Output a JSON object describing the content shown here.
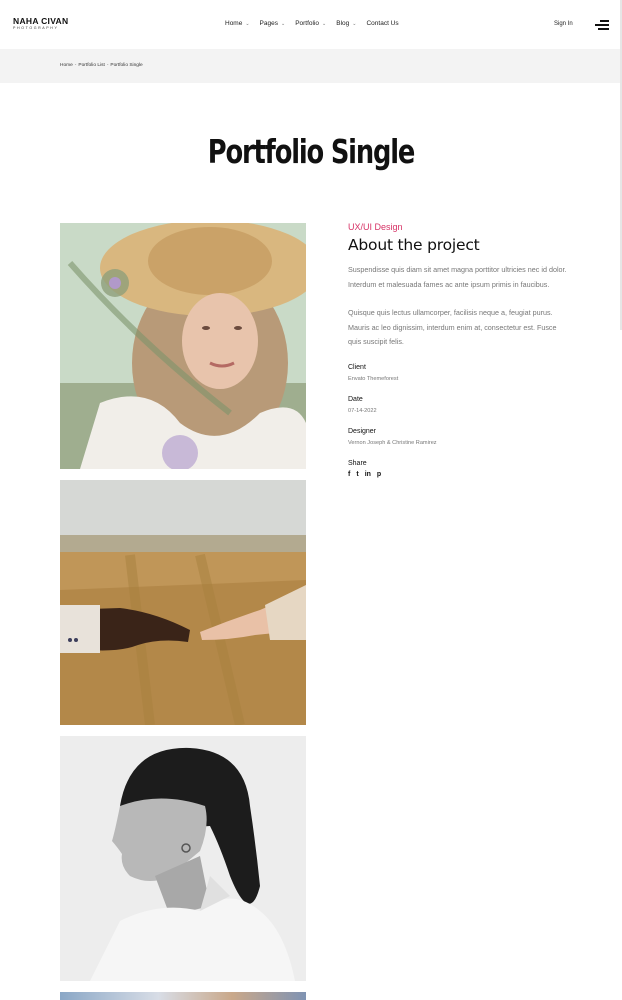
{
  "brand": {
    "name": "NAHA CIVAN",
    "tagline": "PHOTOGRAPHY"
  },
  "nav": {
    "items": [
      {
        "label": "Home",
        "has_dropdown": true
      },
      {
        "label": "Pages",
        "has_dropdown": true
      },
      {
        "label": "Portfolio",
        "has_dropdown": true
      },
      {
        "label": "Blog",
        "has_dropdown": true
      },
      {
        "label": "Contact Us",
        "has_dropdown": false
      }
    ],
    "sign_in": "Sign In",
    "menu_icon": "hamburger-menu-icon"
  },
  "breadcrumb": {
    "items": [
      "Home",
      "Portfolio List",
      "Portfolio Single"
    ],
    "separator": "-"
  },
  "page_title": "Portfolio Single",
  "project": {
    "category": "UX/UI Design",
    "title": "About the project",
    "paragraph_1": "Suspendisse quis diam sit amet magna porttitor ultricies nec id dolor. Interdum et malesuada fames ac ante ipsum primis in faucibus.",
    "paragraph_2": "Quisque quis lectus ullamcorper, facilisis neque a, feugiat purus. Mauris ac leo dignissim, interdum enim at, consectetur est. Fusce quis suscipit felis.",
    "meta": [
      {
        "label": "Client",
        "value": "Envato Themeforest"
      },
      {
        "label": "Date",
        "value": "07-14-2022"
      },
      {
        "label": "Designer",
        "value": "Vernon Joseph & Christine Ramirez"
      }
    ],
    "share_label": "Share",
    "share_icons": [
      {
        "name": "facebook-icon",
        "glyph": "f"
      },
      {
        "name": "twitter-icon",
        "glyph": "t"
      },
      {
        "name": "linkedin-icon",
        "glyph": "in"
      },
      {
        "name": "pinterest-icon",
        "glyph": "p"
      }
    ]
  },
  "colors": {
    "accent": "#d63366",
    "breadcrumb_bg": "#f3f3f3",
    "text": "#111111",
    "muted": "#777777"
  }
}
